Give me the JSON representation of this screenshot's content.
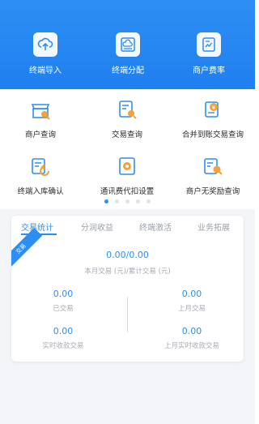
{
  "header_actions": [
    {
      "label": "终端导入",
      "icon": "cloud-upload-icon"
    },
    {
      "label": "终端分配",
      "icon": "cloud-distribute-icon"
    },
    {
      "label": "商户费率",
      "icon": "rate-document-icon"
    }
  ],
  "grid_menu": [
    {
      "label": "商户查询",
      "icon": "store-search-icon"
    },
    {
      "label": "交易查询",
      "icon": "transaction-search-icon"
    },
    {
      "label": "合并到账交易查询",
      "icon": "merged-settlement-search-icon"
    },
    {
      "label": "终端入库确认",
      "icon": "terminal-inbound-icon"
    },
    {
      "label": "通讯费代扣设置",
      "icon": "fee-deduction-settings-icon"
    },
    {
      "label": "商户无奖励查询",
      "icon": "no-reward-search-icon"
    }
  ],
  "pagination": {
    "total": 5,
    "active_index": 0
  },
  "stats_card": {
    "tabs": [
      "交易统计",
      "分润收益",
      "终端激活",
      "业务拓展"
    ],
    "active_tab": 0,
    "ribbon_label": "交易",
    "summary_value": "0.00/0.00",
    "summary_caption": "本月交易 (元)/累计交易 (元)",
    "left_stats": [
      {
        "value": "0.00",
        "caption": "已交易"
      },
      {
        "value": "0.00",
        "caption": "实时收款交易"
      }
    ],
    "right_stats": [
      {
        "value": "0.00",
        "caption": "上月交易"
      },
      {
        "value": "0.00",
        "caption": "上月实时收款交易"
      }
    ]
  },
  "colors": {
    "primary": "#2d8ff3",
    "muted_text": "#a6abb3",
    "icon_orange": "#f2a33a"
  }
}
